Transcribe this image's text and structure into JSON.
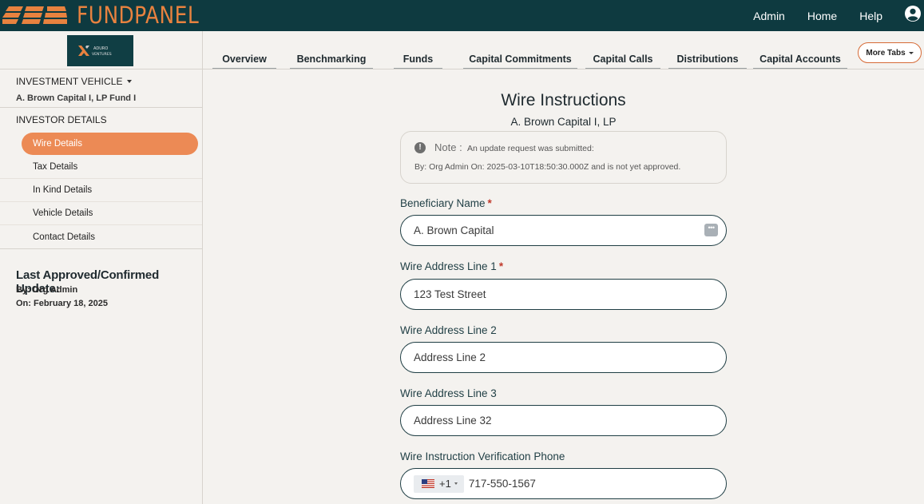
{
  "app": {
    "name": "FUNDPANEL"
  },
  "topnav": {
    "items": [
      "Admin",
      "Home",
      "Help"
    ]
  },
  "brand": {
    "line1": "ADURO",
    "line2": "VENTURES"
  },
  "sidebar": {
    "investment_vehicle_label": "INVESTMENT VEHICLE",
    "investment_vehicle_value": "A. Brown Capital I, LP Fund I",
    "investor_details_label": "INVESTOR DETAILS",
    "items": [
      {
        "label": "Wire Details",
        "active": true
      },
      {
        "label": "Tax Details"
      },
      {
        "label": "In Kind Details"
      },
      {
        "label": "Vehicle Details"
      },
      {
        "label": "Contact Details"
      }
    ],
    "last_update": {
      "title": "Last Approved/Confirmed Update:",
      "by": "By: Org Admin",
      "on": "On: February 18, 2025"
    }
  },
  "tabs": [
    "Overview",
    "Benchmarking",
    "Funds",
    "Capital Commitments",
    "Capital Calls",
    "Distributions",
    "Capital Accounts"
  ],
  "more_tabs_label": "More Tabs",
  "main": {
    "title": "Wire Instructions",
    "subtitle": "A. Brown Capital I, LP",
    "note": {
      "label": "Note :",
      "message": "An update request was submitted:",
      "detail": "By: Org Admin On: 2025-03-10T18:50:30.000Z and is not yet approved."
    },
    "fields": {
      "beneficiary_name": {
        "label": "Beneficiary Name",
        "value": "A. Brown Capital",
        "required": true
      },
      "address1": {
        "label": "Wire Address Line 1",
        "value": "123 Test Street",
        "required": true
      },
      "address2": {
        "label": "Wire Address Line 2",
        "value": "Address Line 2"
      },
      "address3": {
        "label": "Wire Address Line 3",
        "value": "Address Line 32"
      },
      "phone": {
        "label": "Wire Instruction Verification Phone",
        "country_code": "+1",
        "value": "717-550-1567"
      }
    }
  },
  "colors": {
    "topbar": "#0e3a40",
    "accent": "#ec8a55",
    "logo": "#e8823f"
  }
}
